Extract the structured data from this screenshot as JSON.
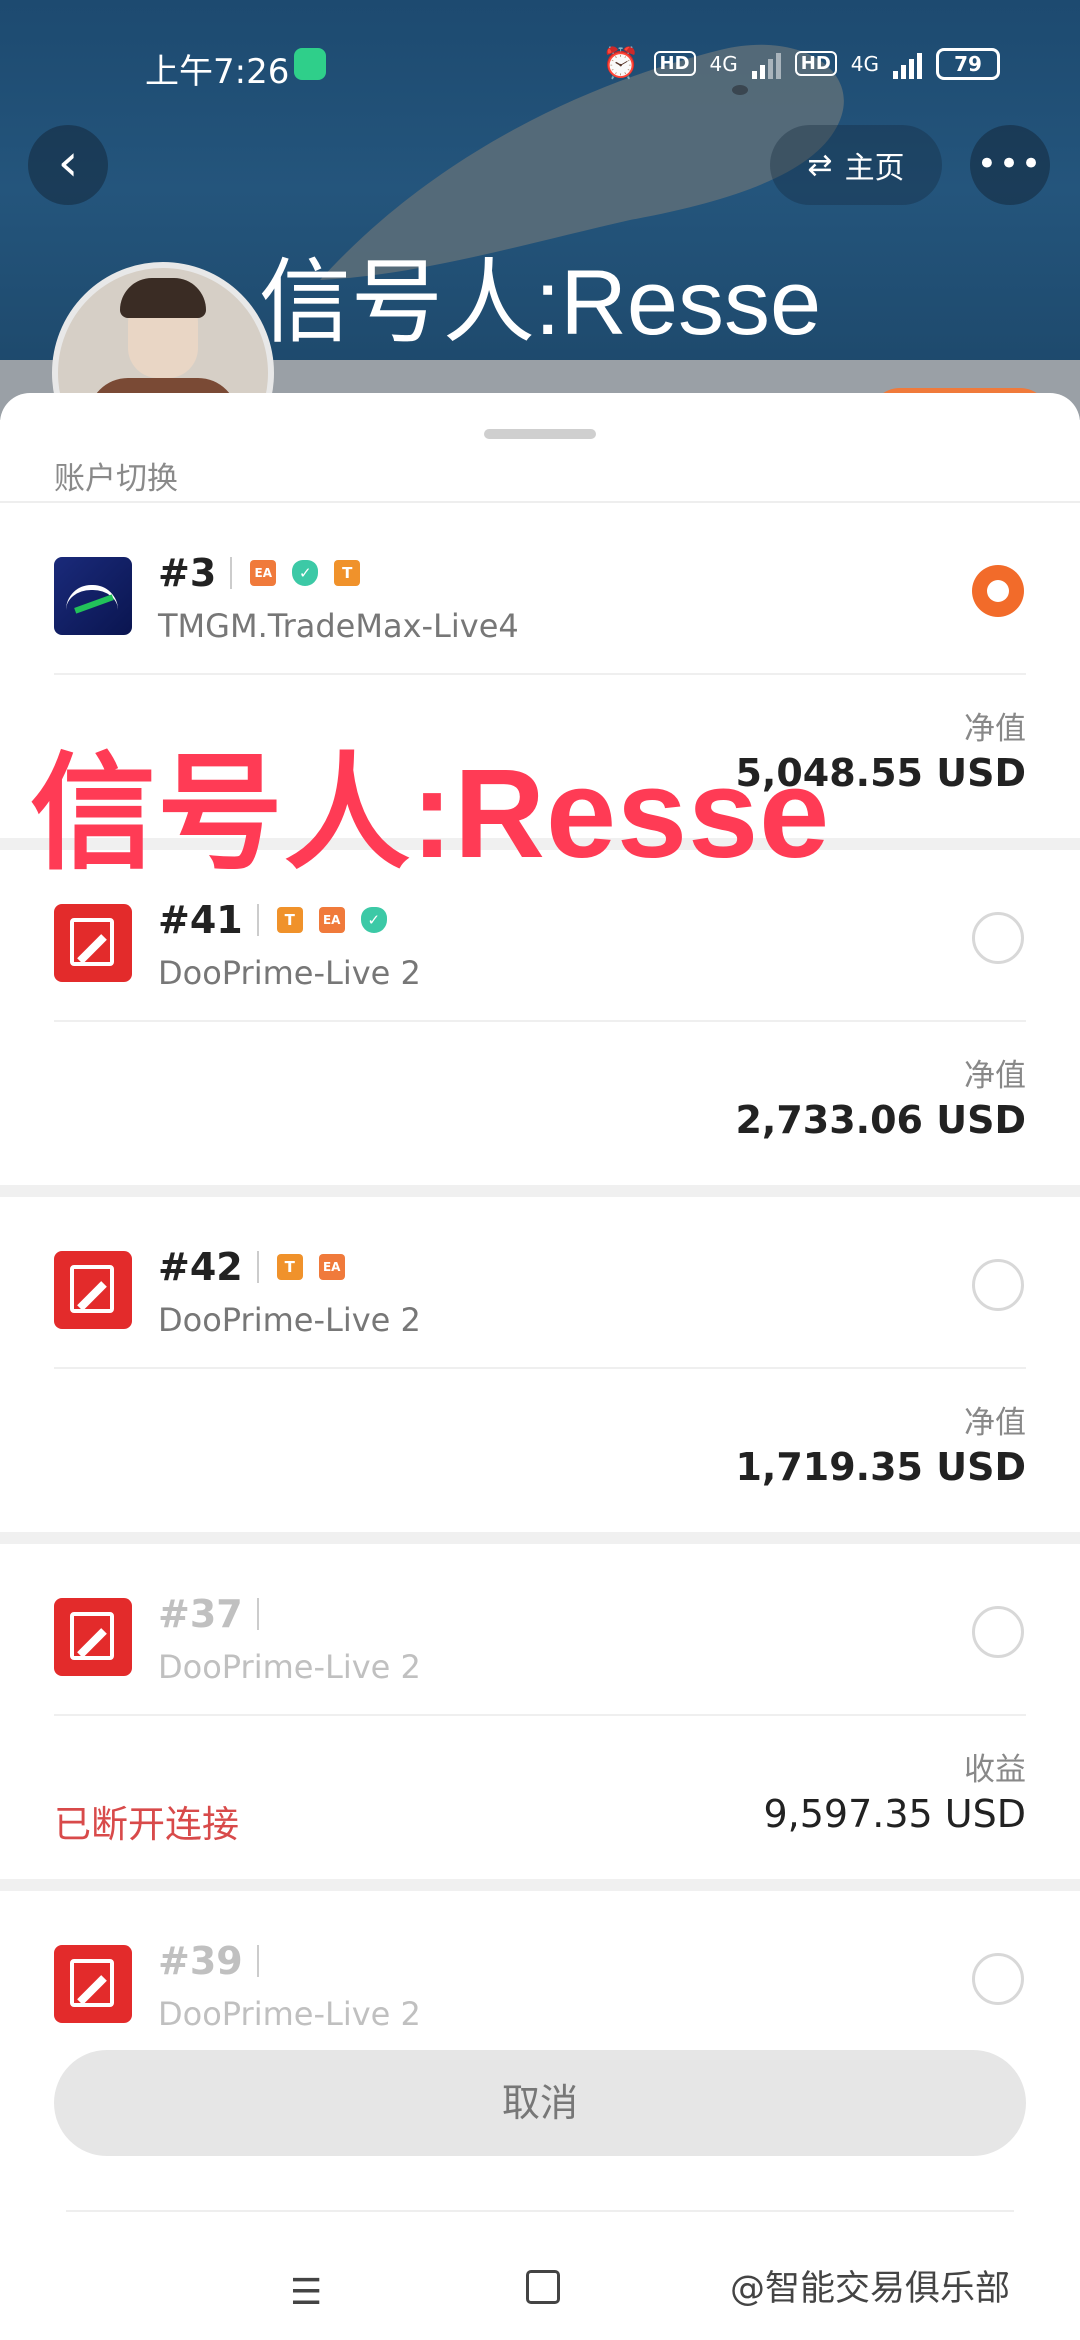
{
  "status_bar": {
    "time": "上午7:26",
    "hd1": "HD",
    "net1": "4G",
    "hd2": "HD",
    "net2": "4G",
    "battery": "79"
  },
  "header": {
    "title": "信号人:Resse",
    "home_label": "主页",
    "back_icon": "chevron-left-icon",
    "more_icon": "more-dots-icon"
  },
  "sheet": {
    "title": "账户切换",
    "cancel_label": "取消",
    "accounts": [
      {
        "number": "#3",
        "tags": [
          "EA",
          "V",
          "T"
        ],
        "server": "TMGM.TradeMax-Live4",
        "metric_label": "净值",
        "metric_value": "5,048.55 USD",
        "selected": true
      },
      {
        "number": "#41",
        "tags": [
          "T",
          "EA",
          "V"
        ],
        "server": "DooPrime-Live 2",
        "metric_label": "净值",
        "metric_value": "2,733.06 USD",
        "selected": false
      },
      {
        "number": "#42",
        "tags": [
          "T",
          "EA"
        ],
        "server": "DooPrime-Live 2",
        "metric_label": "净值",
        "metric_value": "1,719.35 USD",
        "selected": false
      },
      {
        "number": "#37",
        "tags": [],
        "server": "DooPrime-Live 2",
        "metric_label": "收益",
        "metric_value": "9,597.35 USD",
        "status": "已断开连接",
        "selected": false
      },
      {
        "number": "#39",
        "tags": [],
        "server": "DooPrime-Live 2",
        "selected": false
      }
    ]
  },
  "overlay_text": "信号人:Resse",
  "watermark": "@智能交易俱乐部",
  "colors": {
    "accent": "#f26b2a",
    "overlay": "#ff3b55",
    "disconnected": "#d84a4a",
    "header_bg": "#24557c"
  }
}
